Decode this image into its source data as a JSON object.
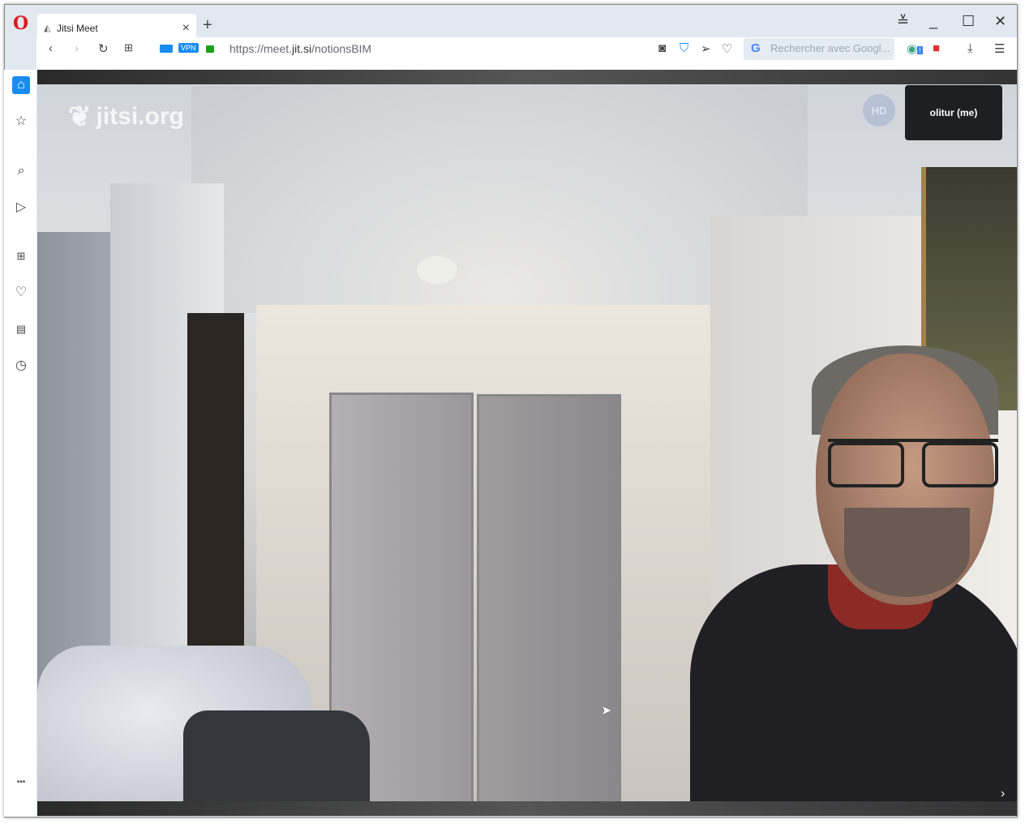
{
  "browser": {
    "tab_title": "Jitsi Meet",
    "url_prefix": "https://meet.",
    "url_domain": "jit.si",
    "url_path": "/notionsBIM",
    "vpn_label": "VPN",
    "search_placeholder": "Rechercher avec Googl...",
    "search_engine_glyph": "G",
    "extension_badge": "!"
  },
  "sidebar": {
    "items": [
      "home-icon",
      "star-icon",
      "search-icon",
      "send-icon",
      "grid-icon",
      "heart-icon",
      "news-icon",
      "history-icon"
    ],
    "more": "•••"
  },
  "meeting": {
    "logo_text": "jitsi.org",
    "quality_badge": "HD",
    "local_participant": "olitur (me)",
    "accent": "#1a8cf0"
  }
}
